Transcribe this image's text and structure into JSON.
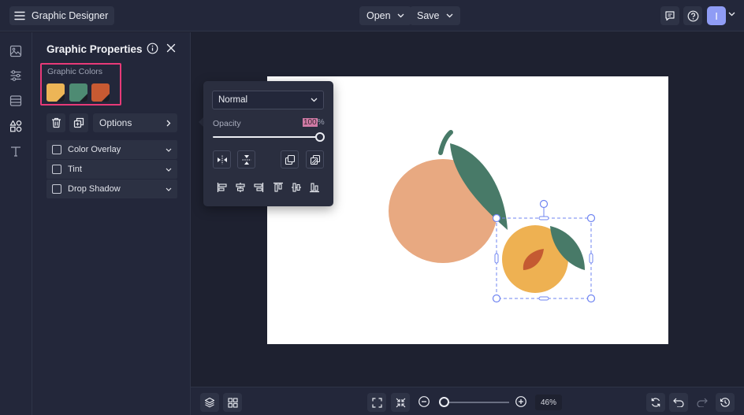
{
  "header": {
    "app_title": "Graphic Designer",
    "open_label": "Open",
    "save_label": "Save",
    "avatar_initial": "I"
  },
  "rail": {
    "icons": [
      "image-icon",
      "sliders-icon",
      "layout-icon",
      "shapes-icon",
      "text-icon"
    ]
  },
  "panel": {
    "title": "Graphic Properties",
    "colors_label": "Graphic Colors",
    "swatches": [
      "#edb556",
      "#4e8b73",
      "#c85a32"
    ],
    "options_label": "Options",
    "effects": [
      {
        "label": "Color Overlay",
        "checked": false
      },
      {
        "label": "Tint",
        "checked": false
      },
      {
        "label": "Drop Shadow",
        "checked": false
      }
    ]
  },
  "popover": {
    "blend_mode": "Normal",
    "opacity_label": "Opacity",
    "opacity_value": "100",
    "opacity_unit": "%",
    "opacity_fraction": 1.0
  },
  "bottom": {
    "zoom_value": "46",
    "zoom_unit": "%"
  },
  "colors": {
    "accent_highlight": "#e83a78",
    "peach_big": "#e8a981",
    "leaf": "#487a68",
    "peach_small": "#eeb152",
    "pit": "#c45a32",
    "selection": "#6f84f1"
  }
}
